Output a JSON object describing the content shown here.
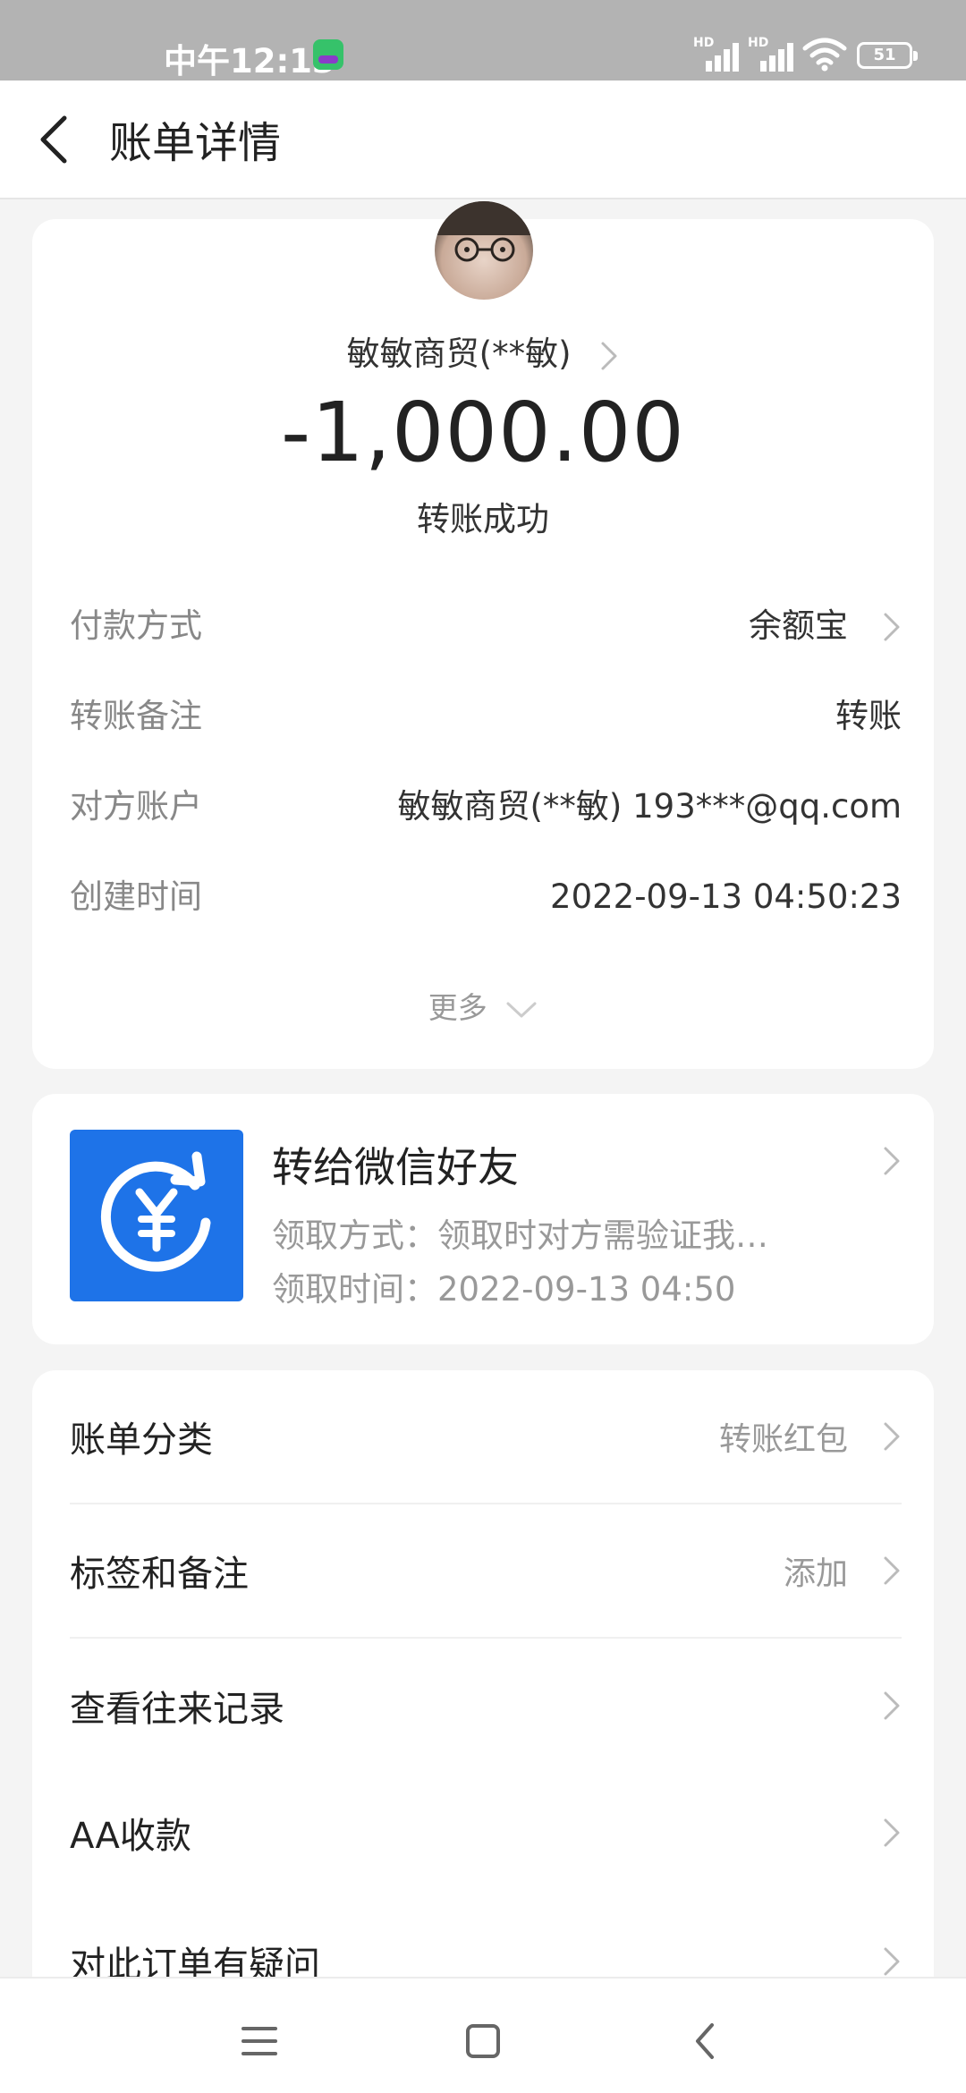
{
  "status_bar": {
    "time": "中午12:13",
    "signal1_label": "HD",
    "signal2_label": "HD",
    "battery": "51"
  },
  "header": {
    "title": "账单详情"
  },
  "bill": {
    "merchant": "敏敏商贸(**敏)",
    "amount": "-1,000.00",
    "status": "转账成功",
    "details": [
      {
        "label": "付款方式",
        "value": "余额宝",
        "arrow": true
      },
      {
        "label": "转账备注",
        "value": "转账",
        "arrow": false
      },
      {
        "label": "对方账户",
        "value": "敏敏商贸(**敏) 193***@qq.com",
        "arrow": false
      },
      {
        "label": "创建时间",
        "value": "2022-09-13 04:50:23",
        "arrow": false
      }
    ],
    "more_label": "更多"
  },
  "transfer": {
    "title": "转给微信好友",
    "method": "领取方式：领取时对方需验证我…",
    "time": "领取时间：2022-09-13 04:50",
    "icon": "yen-refresh-icon"
  },
  "menu": [
    {
      "label": "账单分类",
      "value": "转账红包"
    },
    {
      "label": "标签和备注",
      "value": "添加"
    },
    {
      "label": "查看往来记录",
      "value": ""
    },
    {
      "label": "AA收款",
      "value": ""
    },
    {
      "label": "对此订单有疑问",
      "value": ""
    }
  ],
  "colors": {
    "accent_blue": "#1e73e8",
    "status_bar_bg": "#b3b3b3",
    "page_bg": "#f4f4f4"
  }
}
